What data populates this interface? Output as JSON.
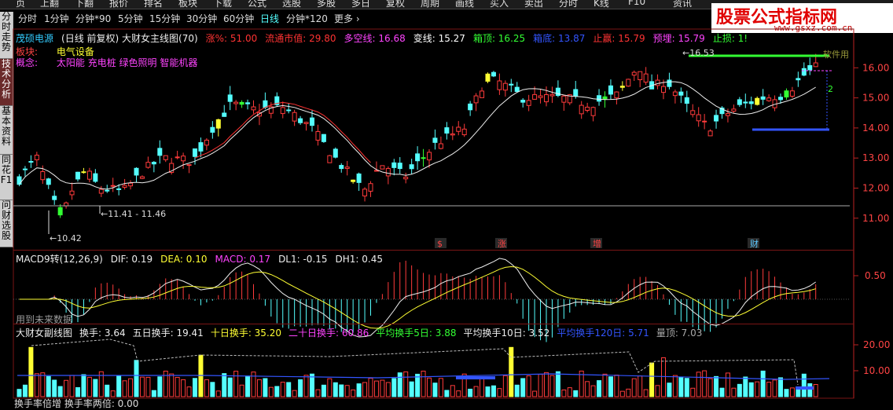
{
  "top_menu": [
    "页",
    "上翻",
    "下翻",
    "报价",
    "排名",
    "板块",
    "下载",
    "公式",
    "选股",
    "多股",
    "多日",
    "复权",
    "周期",
    "画线",
    "买入",
    "卖出",
    "分时",
    "K线",
    "F10",
    "资讯"
  ],
  "period_bar": {
    "items": [
      "分时",
      "1分钟",
      "分钟*90",
      "5分钟",
      "15分钟",
      "30分钟",
      "60分钟",
      "日线",
      "分钟*120",
      "更多 ›"
    ],
    "active": "日线"
  },
  "side_tabs": [
    "分时走势",
    "技术分析",
    "基本资料",
    "同花F1",
    "问财选股"
  ],
  "side_tab_active": "技术分析",
  "watermark": {
    "title": "股票公式指标网",
    "url": "www.gsxz.com.cn"
  },
  "main_header": [
    {
      "text": "茂硕电源",
      "color": "#33ccff"
    },
    {
      "text": "(日线 前复权) 大财女主线图(70)",
      "color": "#eeeeee"
    },
    {
      "text": "涨%: 51.00",
      "color": "#ff3333"
    },
    {
      "text": "流通市值: 29.80",
      "color": "#ff3333"
    },
    {
      "text": "多空线: 16.68",
      "color": "#ff44ff"
    },
    {
      "text": "变线: 15.27",
      "color": "#ffffff"
    },
    {
      "text": "箱顶: 16.25",
      "color": "#33ff33"
    },
    {
      "text": "箱底: 13.87",
      "color": "#3355ff"
    },
    {
      "text": "止赢: 15.79",
      "color": "#ff3333"
    },
    {
      "text": "预埋: 15.79",
      "color": "#ff44ff"
    },
    {
      "text": "止损: 1!",
      "color": "#33ff33"
    }
  ],
  "sector": {
    "label": "板块:",
    "value": "电气设备"
  },
  "concept": {
    "label": "概念:",
    "value": "太阳能 充电桩 绿色照明 智能机器"
  },
  "main_chart": {
    "type": "candlestick",
    "price_min": 10.42,
    "price_max": 16.53,
    "y_ticks": [
      "16.00",
      "15.00",
      "14.00",
      "13.00",
      "12.00",
      "11.00"
    ],
    "annotations": [
      "10.42",
      "11.41 - 11.46",
      "16.53",
      "2",
      "软件用"
    ],
    "signals": [
      "$",
      "涨",
      "增",
      "财"
    ]
  },
  "macd_panel": {
    "header": [
      {
        "text": "MACD9转(12,26,9)",
        "color": "#eeeeee"
      },
      {
        "text": "DIF: 0.19",
        "color": "#eeeeee"
      },
      {
        "text": "DEA: 0.10",
        "color": "#ffff33"
      },
      {
        "text": "MACD: 0.17",
        "color": "#ff44ff"
      },
      {
        "text": "DL1: -0.15",
        "color": "#eeeeee"
      },
      {
        "text": "DH1: 0.45",
        "color": "#eeeeee"
      }
    ],
    "y_ticks": [
      "0.50"
    ],
    "note": "用到未来数据"
  },
  "volume_panel": {
    "header": [
      {
        "text": "大财女副线图",
        "color": "#eeeeee"
      },
      {
        "text": "换手: 3.64",
        "color": "#eeeeee"
      },
      {
        "text": "五日换手: 19.41",
        "color": "#eeeeee"
      },
      {
        "text": "十日换手: 35.20",
        "color": "#ffff33"
      },
      {
        "text": "二十日换手: 60.86",
        "color": "#ff44ff"
      },
      {
        "text": "平均换手5日: 3.88",
        "color": "#33ff33"
      },
      {
        "text": "平均换手10日: 3.52",
        "color": "#eeeeee"
      },
      {
        "text": "平均换手120日: 5.71",
        "color": "#3355ff"
      },
      {
        "text": "量顶: 7.03",
        "color": "#aaaaaa"
      }
    ],
    "y_ticks": [
      "20.00",
      "10.00"
    ]
  },
  "bottom_status": "换手率倍增  换手率两倍: 0.00"
}
